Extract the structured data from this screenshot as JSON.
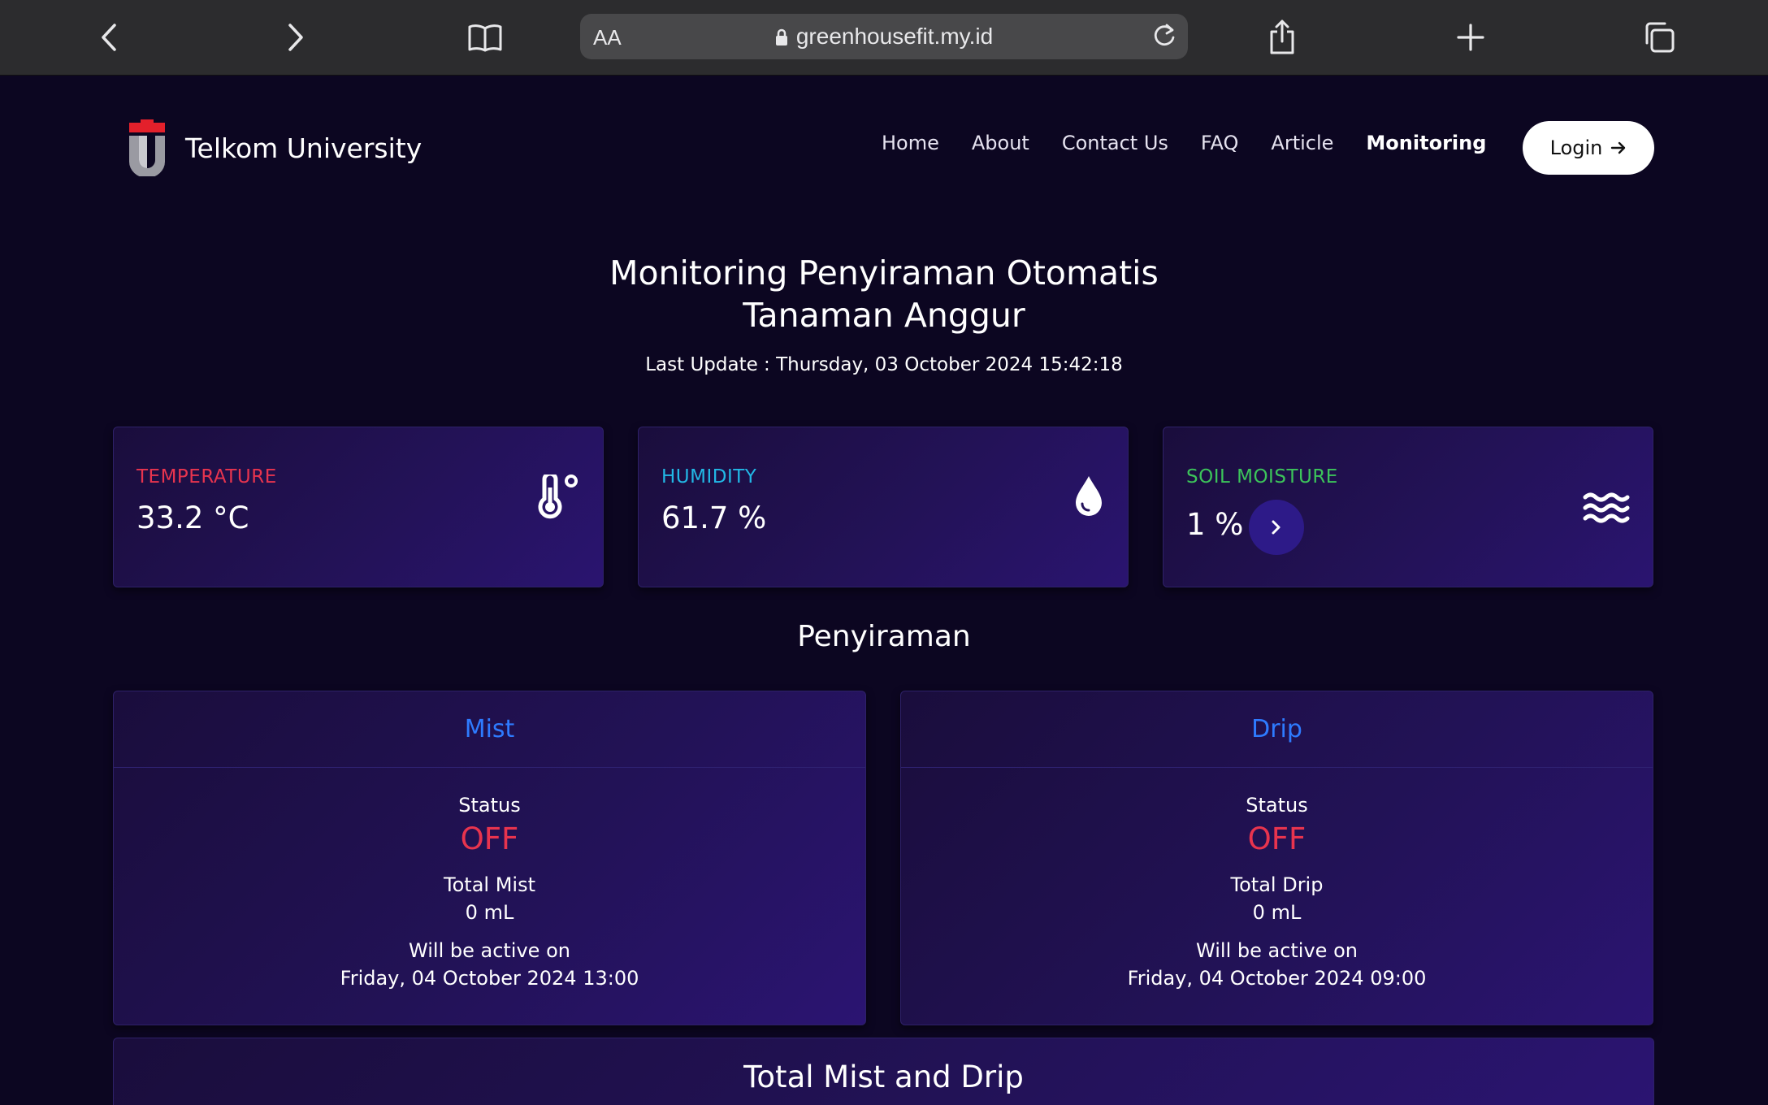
{
  "browser": {
    "url_text_size": "AA",
    "host": "greenhousefit.my.id"
  },
  "nav": {
    "brand": "Telkom University",
    "items": [
      "Home",
      "About",
      "Contact Us",
      "FAQ",
      "Article",
      "Monitoring"
    ],
    "active": "Monitoring",
    "login_label": "Login"
  },
  "header": {
    "title_line1": "Monitoring Penyiraman Otomatis",
    "title_line2": "Tanaman Anggur",
    "last_update": "Last Update : Thursday, 03 October 2024 15:42:18"
  },
  "sensors": {
    "temperature": {
      "label": "TEMPERATURE",
      "value": "33.2 °C",
      "color": "#e8344e",
      "icon": "thermometer-icon"
    },
    "humidity": {
      "label": "HUMIDITY",
      "value": "61.7 %",
      "color": "#22b8e6",
      "icon": "water-drop-icon"
    },
    "soil": {
      "label": "SOIL MOISTURE",
      "value": "1 %",
      "color": "#3cc45a",
      "icon": "waves-icon"
    }
  },
  "watering": {
    "section_title": "Penyiraman",
    "mist": {
      "title": "Mist",
      "status_label": "Status",
      "status": "OFF",
      "total_label": "Total Mist",
      "total": "0 mL",
      "active_label": "Will be active on",
      "active_on": "Friday, 04 October 2024 13:00"
    },
    "drip": {
      "title": "Drip",
      "status_label": "Status",
      "status": "OFF",
      "total_label": "Total Drip",
      "total": "0 mL",
      "active_label": "Will be active on",
      "active_on": "Friday, 04 October 2024 09:00"
    }
  },
  "totals": {
    "title": "Total Mist and Drip"
  },
  "colors": {
    "background": "#0c0621",
    "accent_blue": "#2e7bff",
    "status_off": "#e8344e"
  }
}
